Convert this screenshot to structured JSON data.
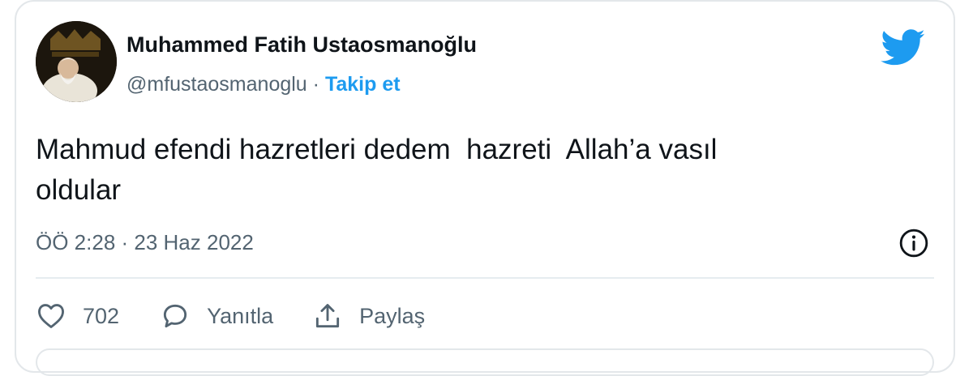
{
  "author": {
    "name": "Muhammed Fatih Ustaosmanoğlu",
    "handle": "@mfustaosmanoglu",
    "separator": "·",
    "follow_label": "Takip et",
    "avatar_icon": "avatar-photo"
  },
  "tweet": {
    "text_line1": "Mahmud efendi hazretleri dedem  hazreti  Allah’a vasıl",
    "text_line2": "oldular",
    "timestamp": "ÖÖ 2:28 · 23 Haz 2022"
  },
  "actions": {
    "like_icon": "heart-icon",
    "like_count": "702",
    "reply_icon": "speech-bubble-icon",
    "reply_label": "Yanıtla",
    "share_icon": "share-icon",
    "share_label": "Paylaş"
  },
  "colors": {
    "twitter_blue": "#1d9bf0",
    "text_primary": "#0f1419",
    "text_secondary": "#536471",
    "border": "#e3e7ea"
  }
}
